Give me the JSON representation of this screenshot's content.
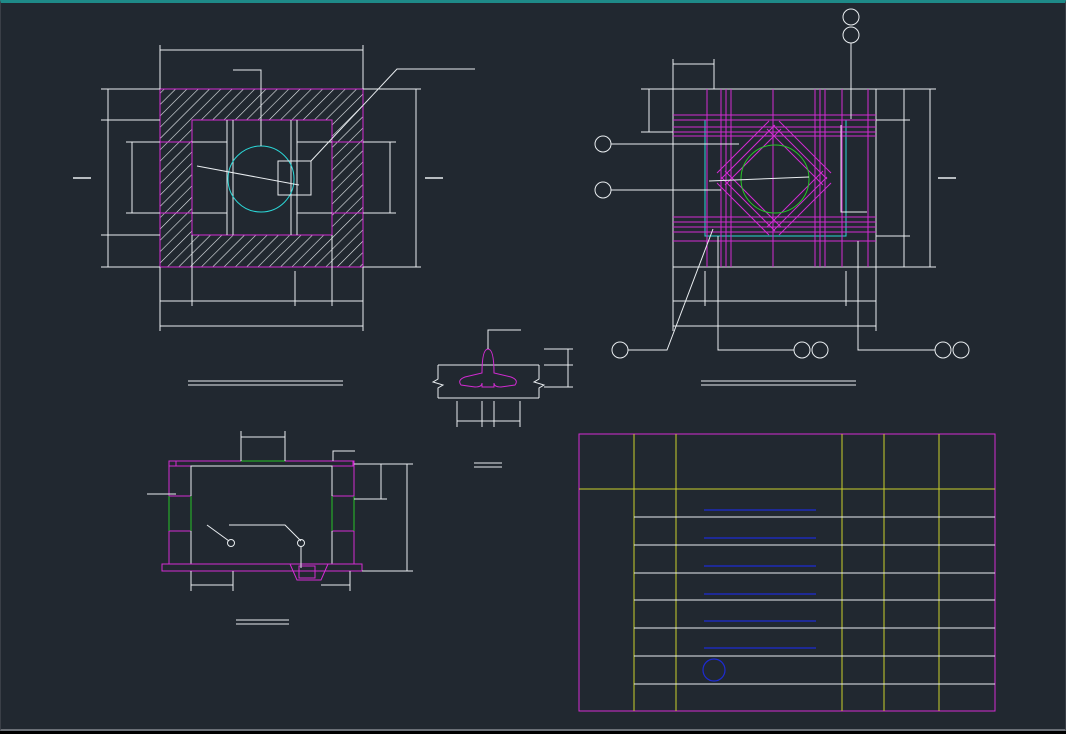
{
  "drawing": {
    "background": "#212830",
    "colors": {
      "outline": "#e9edf0",
      "hatch": "#d22bd2",
      "pipe": "#2bd6d6",
      "rebar": "#28c428",
      "table_grid": "#c9cf2b",
      "table_lines": "#1d2bd2",
      "frame_accent": "#1e8a88"
    }
  },
  "views": [
    {
      "id": "plan-view",
      "kind": "hatched-wall-plan"
    },
    {
      "id": "reinforcement-view",
      "kind": "rebar-layout-plan"
    },
    {
      "id": "section-view",
      "kind": "cross-section"
    },
    {
      "id": "bar-detail",
      "kind": "hook-detail"
    },
    {
      "id": "schedule-table",
      "kind": "table",
      "rows": 10,
      "columns": 7
    }
  ]
}
